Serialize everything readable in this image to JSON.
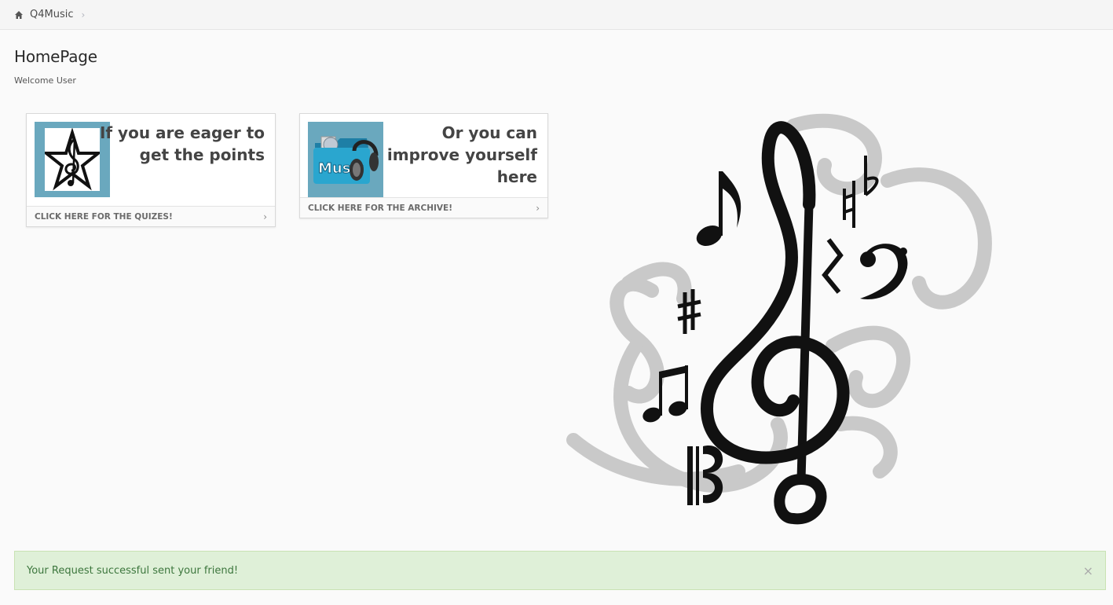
{
  "breadcrumb": {
    "home_icon": "home-icon",
    "items": [
      "Q4Music"
    ]
  },
  "header": {
    "title": "HomePage",
    "subtitle": "Welcome User"
  },
  "cards": [
    {
      "text_line1": "If you are eager to",
      "text_line2": "get the points",
      "footer": "CLICK HERE FOR THE QUIZES!",
      "icon": "treble-star-icon"
    },
    {
      "text_line1": "Or you can",
      "text_line2": "improve yourself",
      "text_line3": "here",
      "footer": "CLICK HERE FOR THE ARCHIVE!",
      "icon": "music-folder-icon"
    }
  ],
  "alert": {
    "message": "Your Request successful sent your friend!",
    "close": "×"
  },
  "colors": {
    "thumb_bg": "#6aa8be",
    "alert_bg": "#dff0d8",
    "alert_text": "#3c763d"
  }
}
